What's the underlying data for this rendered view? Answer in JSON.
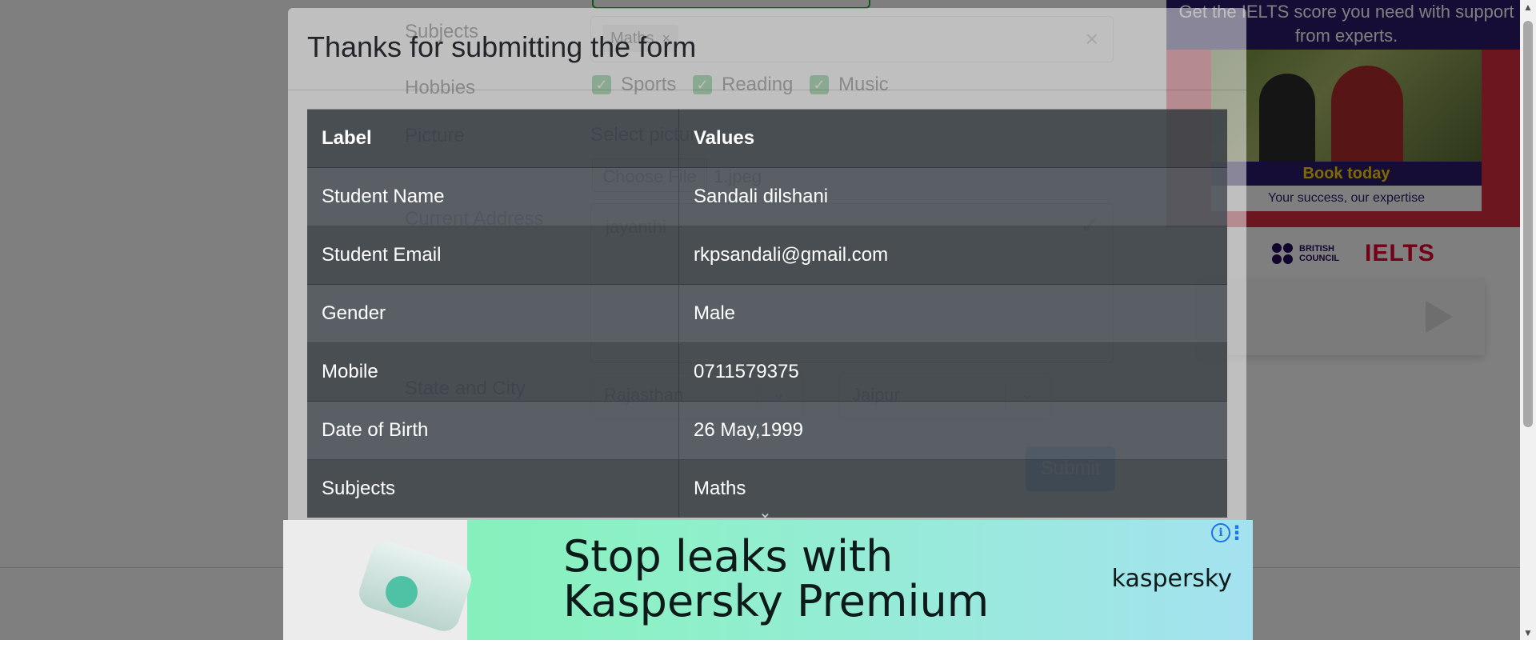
{
  "form": {
    "subjects_label": "Subjects",
    "subject_chip": "Maths",
    "chip_remove": "×",
    "clear": "×",
    "hobbies_label": "Hobbies",
    "hobbies": [
      "Sports",
      "Reading",
      "Music"
    ],
    "picture_label": "Picture",
    "select_picture": "Select picture",
    "choose_file": "Choose File",
    "file_name": "1.jpeg",
    "address_label": "Current Address",
    "address_value": "jayanthi",
    "state_city_label": "State and City",
    "state_value": "Rajasthan",
    "city_value": "Jaipur",
    "submit_label": "Submit"
  },
  "modal": {
    "title": "Thanks for submitting the form",
    "headers": {
      "label": "Label",
      "values": "Values"
    },
    "rows": [
      {
        "label": "Student Name",
        "value": "Sandali dilshani"
      },
      {
        "label": "Student Email",
        "value": "rkpsandali@gmail.com"
      },
      {
        "label": "Gender",
        "value": "Male"
      },
      {
        "label": "Mobile",
        "value": "0711579375"
      },
      {
        "label": "Date of Birth",
        "value": "26 May,1999"
      },
      {
        "label": "Subjects",
        "value": "Maths"
      }
    ]
  },
  "ad_right": {
    "headline": "Get the IELTS score you need with support from experts.",
    "cta": "Book today",
    "tagline": "Your success, our expertise",
    "brand": "BRITISH COUNCIL",
    "brand_product": "IELTS"
  },
  "ad_bottom": {
    "headline_line1": "Stop leaks with",
    "headline_line2": "Kaspersky Premium",
    "brand": "kaspersky",
    "info_icon_text": "i",
    "more_icon_text": "⋮"
  },
  "colors": {
    "success": "#28a745",
    "primary": "#007bff",
    "ielts_red": "#e4032e",
    "british_council_navy": "#23085a"
  },
  "icons": {
    "checkbox": "check-icon",
    "dropdown": "chevron-down-icon",
    "valid": "checkmark-icon"
  }
}
